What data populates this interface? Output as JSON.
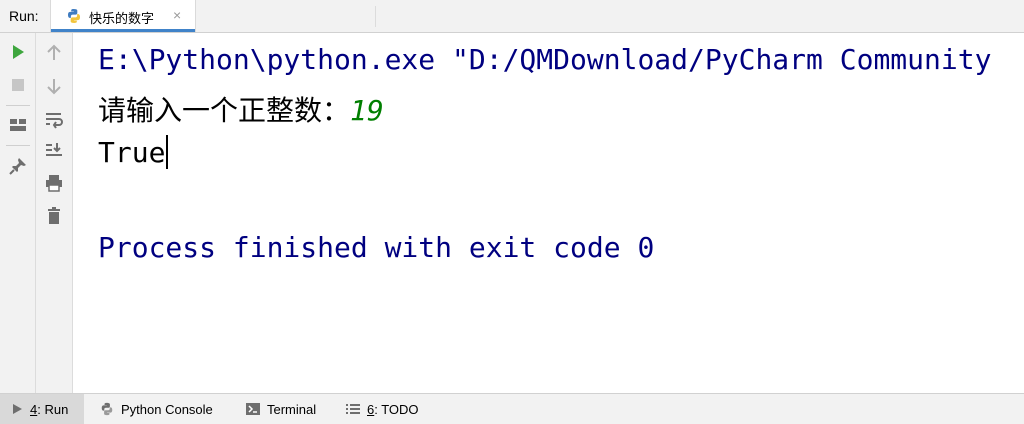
{
  "header": {
    "run_label": "Run:",
    "tab_title": "快乐的数字",
    "tab_close": "×"
  },
  "toolbar": {
    "left": [
      "run-icon",
      "stop-icon",
      "layout-icon",
      "pin-icon"
    ],
    "right": [
      "up-arrow-icon",
      "down-arrow-icon",
      "soft-wrap-icon",
      "scroll-to-end-icon",
      "print-icon",
      "trash-icon"
    ]
  },
  "console": {
    "command": "E:\\Python\\python.exe \"D:/QMDownload/PyCharm Community",
    "prompt": "请输入一个正整数：",
    "input_value": "19",
    "result": "True",
    "exit_message": "Process finished with exit code 0"
  },
  "bottom_tabs": [
    {
      "num": "4",
      "label": ": Run",
      "icon": "run-triangle-icon"
    },
    {
      "label": "Python Console",
      "icon": "python-icon"
    },
    {
      "label": "Terminal",
      "icon": "terminal-icon"
    },
    {
      "num": "6",
      "label": ": TODO",
      "icon": "todo-icon"
    }
  ],
  "colors": {
    "console_blue": "#000080",
    "input_green": "#007f00",
    "run_green": "#3ea63e",
    "tab_underline": "#4083c9"
  }
}
